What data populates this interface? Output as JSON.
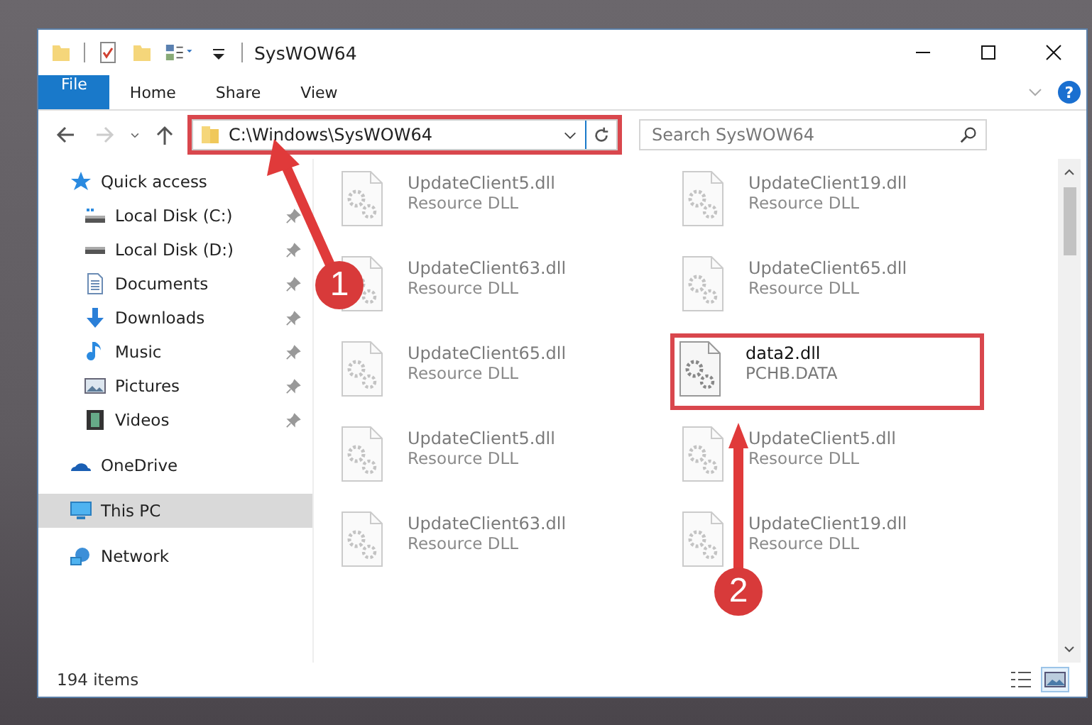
{
  "window": {
    "title": "SysWOW64"
  },
  "ribbon": {
    "tabs": [
      {
        "label": "File",
        "kind": "file",
        "selected": false
      },
      {
        "label": "Home",
        "kind": "tab",
        "selected": false
      },
      {
        "label": "Share",
        "kind": "tab",
        "selected": false
      },
      {
        "label": "View",
        "kind": "tab",
        "selected": false
      }
    ],
    "help": "?"
  },
  "address": {
    "path": "C:\\Windows\\SysWOW64"
  },
  "search": {
    "placeholder": "Search SysWOW64"
  },
  "nav": [
    {
      "label": "Quick access",
      "kind": "star",
      "pinned": false,
      "selected": false,
      "children": [
        {
          "label": "Local Disk (C:)",
          "kind": "drive-c",
          "pinned": true,
          "selected": false
        },
        {
          "label": "Local Disk (D:)",
          "kind": "drive",
          "pinned": true,
          "selected": false
        },
        {
          "label": "Documents",
          "kind": "document",
          "pinned": true,
          "selected": false
        },
        {
          "label": "Downloads",
          "kind": "download",
          "pinned": true,
          "selected": false
        },
        {
          "label": "Music",
          "kind": "music",
          "pinned": true,
          "selected": false
        },
        {
          "label": "Pictures",
          "kind": "pictures",
          "pinned": true,
          "selected": false
        },
        {
          "label": "Videos",
          "kind": "videos",
          "pinned": true,
          "selected": false
        }
      ]
    },
    {
      "label": "OneDrive",
      "kind": "cloud",
      "pinned": false,
      "selected": false
    },
    {
      "label": "This PC",
      "kind": "pc",
      "pinned": false,
      "selected": true
    },
    {
      "label": "Network",
      "kind": "network",
      "pinned": false,
      "selected": false
    }
  ],
  "files": [
    {
      "name": "UpdateClient5.dll",
      "type": "Resource DLL",
      "blurred": true,
      "highlighted": false
    },
    {
      "name": "UpdateClient19.dll",
      "type": "Resource DLL",
      "blurred": true,
      "highlighted": false
    },
    {
      "name": "UpdateClient63.dll",
      "type": "Resource DLL",
      "blurred": true,
      "highlighted": false
    },
    {
      "name": "UpdateClient65.dll",
      "type": "Resource DLL",
      "blurred": true,
      "highlighted": false
    },
    {
      "name": "UpdateClient65.dll",
      "type": "Resource DLL",
      "blurred": true,
      "highlighted": false
    },
    {
      "name": "data2.dll",
      "type": "PCHB.DATA",
      "blurred": false,
      "highlighted": true
    },
    {
      "name": "UpdateClient5.dll",
      "type": "Resource DLL",
      "blurred": true,
      "highlighted": false
    },
    {
      "name": "UpdateClient5.dll",
      "type": "Resource DLL",
      "blurred": true,
      "highlighted": false
    },
    {
      "name": "UpdateClient63.dll",
      "type": "Resource DLL",
      "blurred": true,
      "highlighted": false
    },
    {
      "name": "UpdateClient19.dll",
      "type": "Resource DLL",
      "blurred": true,
      "highlighted": false
    }
  ],
  "status_bar": {
    "count": "194 items",
    "views": [
      {
        "kind": "details",
        "selected": false
      },
      {
        "kind": "large-icons",
        "selected": true
      }
    ]
  },
  "annotations": [
    {
      "label": "1",
      "address_highlighted": true
    },
    {
      "label": "2"
    }
  ]
}
